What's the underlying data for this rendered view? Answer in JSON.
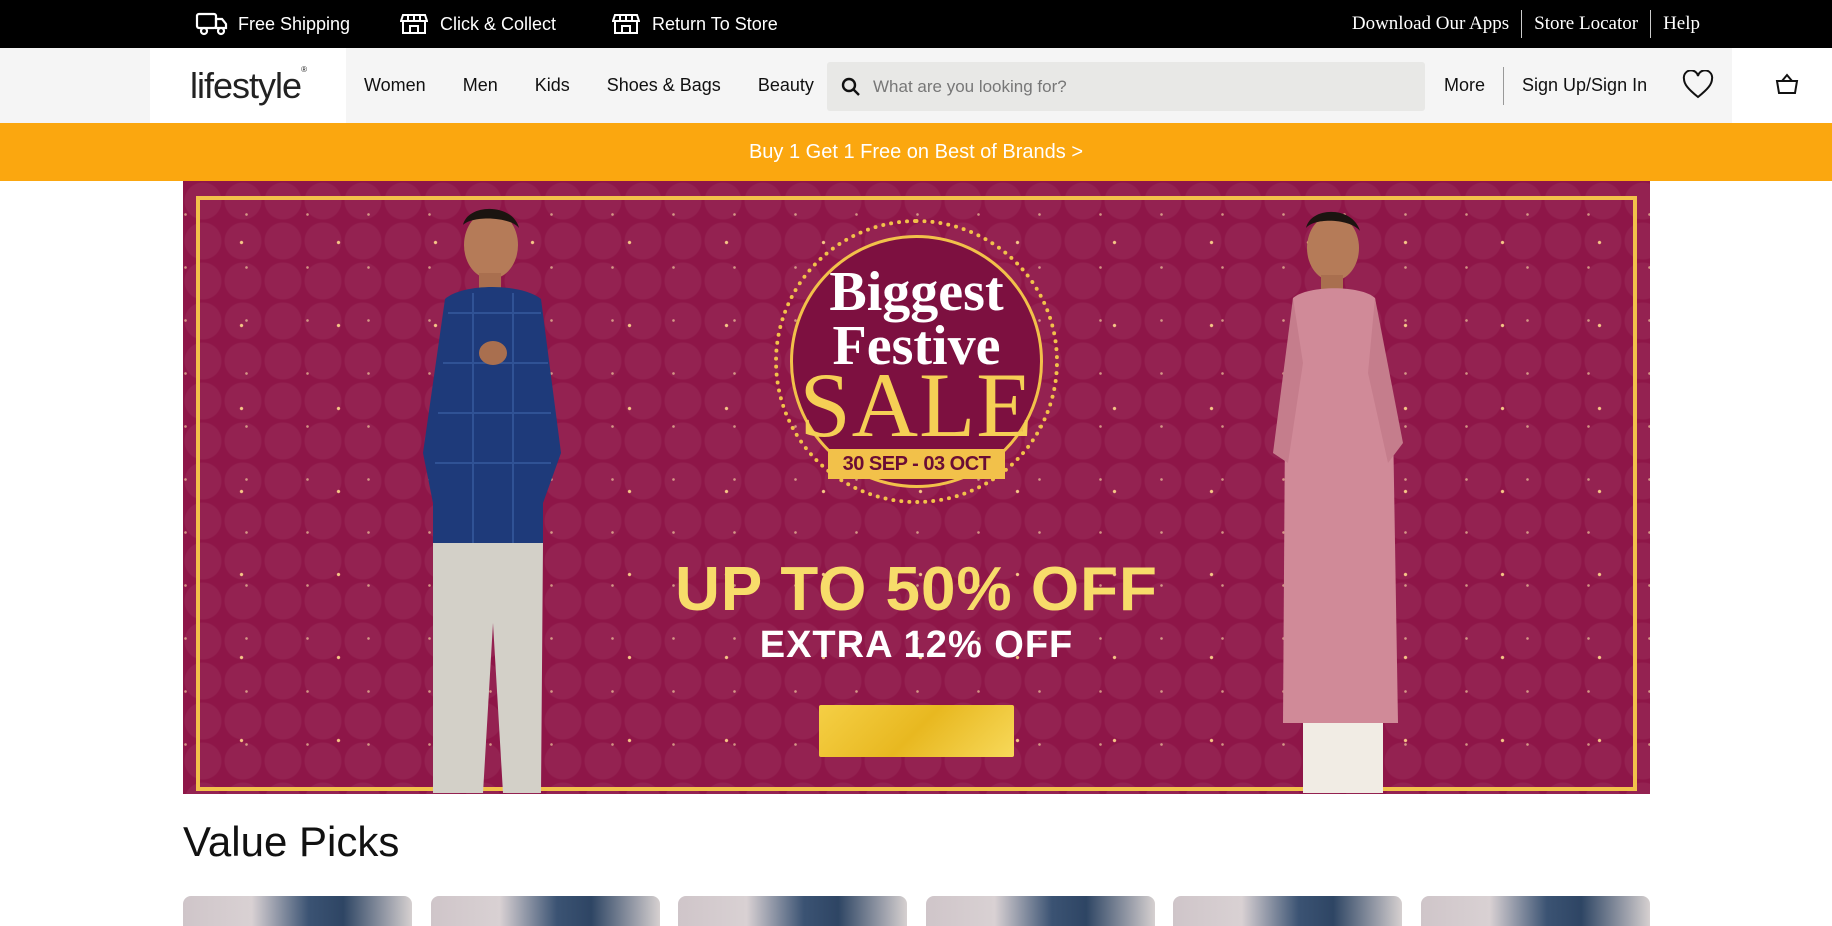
{
  "topbar": {
    "perks": [
      {
        "label": "Free Shipping",
        "icon": "truck-icon"
      },
      {
        "label": "Click & Collect",
        "icon": "store-icon"
      },
      {
        "label": "Return To Store",
        "icon": "store-return-icon"
      }
    ],
    "links": [
      "Download Our Apps",
      "Store Locator",
      "Help"
    ]
  },
  "header": {
    "logo": "lifestyle",
    "nav": [
      "Women",
      "Men",
      "Kids",
      "Shoes & Bags",
      "Beauty"
    ],
    "search": {
      "placeholder": "What are you looking for?",
      "value": ""
    },
    "more": "More",
    "signin": "Sign Up/Sign In"
  },
  "promo": {
    "text": "Buy 1 Get 1 Free on Best of Brands >"
  },
  "banner": {
    "title_line1": "Biggest",
    "title_line2": "Festive",
    "sale": "SALE",
    "dates": "30 SEP - 03 OCT",
    "offer": "UP TO 50% OFF",
    "extra": "EXTRA 12% OFF"
  },
  "section": {
    "title": "Value Picks"
  },
  "colors": {
    "brand_orange": "#fba70f",
    "banner_bg": "#8e1648",
    "gold": "#f2c14a"
  }
}
